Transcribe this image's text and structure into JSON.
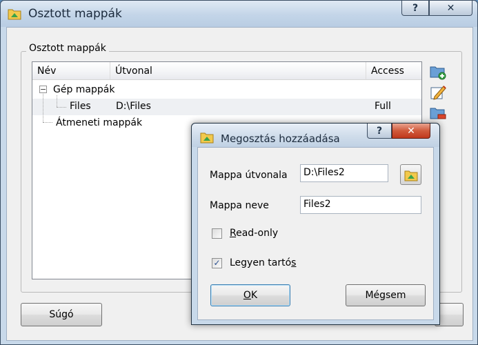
{
  "main_window": {
    "title": "Osztott mappák",
    "help_label": "?",
    "close_label": "✕"
  },
  "group": {
    "label": "Osztott mappák"
  },
  "tree": {
    "columns": [
      "Név",
      "Útvonal",
      "Access"
    ],
    "nodes": {
      "machine_folders": "Gép mappák",
      "files_name": "Files",
      "files_path": "D:\\Files",
      "files_access": "Full",
      "temp_folders": "Átmeneti mappák"
    },
    "expander": "−"
  },
  "side_tools": [
    "add-folder-icon",
    "edit-icon",
    "remove-folder-icon"
  ],
  "help_button": "Súgó",
  "dialog": {
    "title": "Megosztás hozzáadása",
    "help_label": "?",
    "close_label": "✕",
    "path_label": "Mappa útvonala",
    "path_value": "D:\\Files2",
    "name_label": "Mappa neve",
    "name_value": "Files2",
    "readonly_label_first": "R",
    "readonly_label_rest": "ead-only",
    "readonly_checked": false,
    "persistent_label_start": "Legyen tartó",
    "persistent_label_underline": "s",
    "persistent_checked": true,
    "check_mark": "✓",
    "ok_underline": "O",
    "ok_rest": "K",
    "cancel_label": "Mégsem"
  },
  "colors": {
    "window_frame": "#c8d9ea",
    "client": "#f0f0f0",
    "close_red": "#c0381c",
    "folder_yellow": "#f2c94c",
    "folder_green": "#3aa34a"
  }
}
